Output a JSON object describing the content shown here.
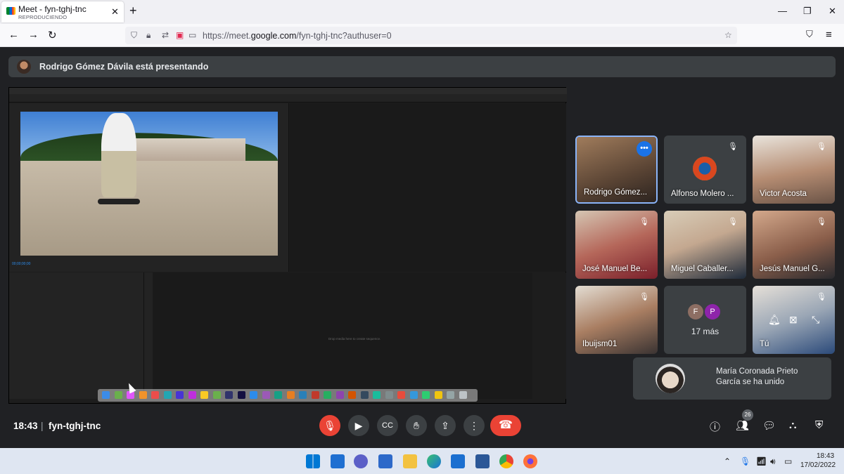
{
  "browser": {
    "tab_title": "Meet - fyn-tghj-tnc",
    "tab_subtitle": "REPRODUCIENDO",
    "url_prefix": "https://meet.",
    "url_domain": "google.com",
    "url_path": "/fyn-tghj-tnc?authuser=0"
  },
  "banner": {
    "text": "Rodrigo Gómez Dávila está presentando"
  },
  "screen": {
    "timeline_empty_msg": "Drop media here to create sequence.",
    "src_timecode": "00;00;00;00"
  },
  "participants": [
    {
      "name": "Rodrigo Gómez...",
      "muted": false
    },
    {
      "name": "Alfonso Molero ...",
      "muted": true
    },
    {
      "name": "Victor Acosta",
      "muted": true
    },
    {
      "name": "José Manuel Be...",
      "muted": true
    },
    {
      "name": "Miguel Caballer...",
      "muted": true
    },
    {
      "name": "Jesús Manuel G...",
      "muted": true
    },
    {
      "name": "Ibuijsm01",
      "muted": true
    },
    {
      "name": "Tú",
      "muted": true
    }
  ],
  "more_tile": {
    "avatars": [
      {
        "letter": "F",
        "color": "#8d6e63"
      },
      {
        "letter": "P",
        "color": "#8e24aa"
      }
    ],
    "label": "17 más"
  },
  "toast": {
    "text": "María Coronada Prieto García se ha unido"
  },
  "bottom_bar": {
    "time": "18:43",
    "separator": "|",
    "meeting_code": "fyn-tghj-tnc",
    "people_count": "26"
  },
  "taskbar": {
    "time": "18:43",
    "date": "17/02/2022"
  },
  "colors": {
    "meet_bg": "#202124",
    "tile_bg": "#3c4043",
    "end_call": "#ea4335",
    "accent_blue": "#1a73e8"
  }
}
